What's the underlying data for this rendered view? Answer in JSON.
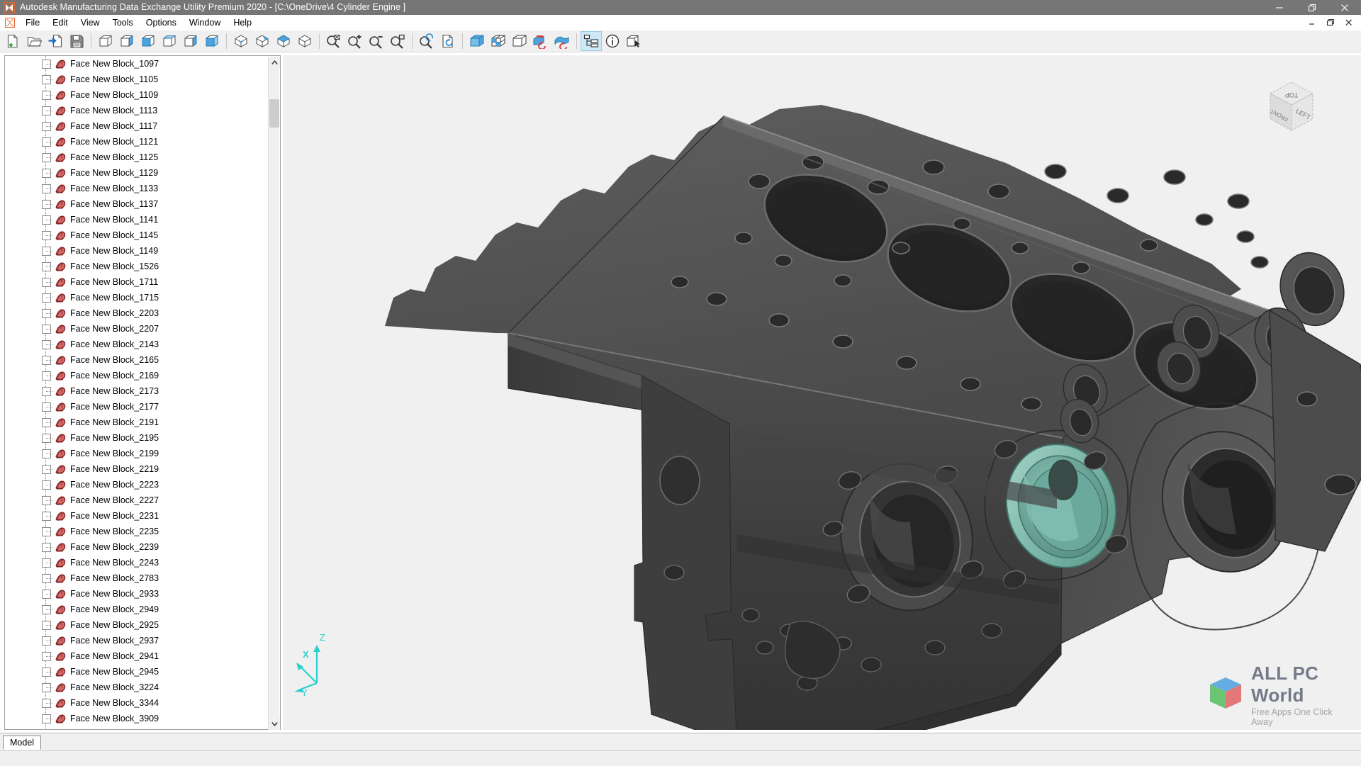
{
  "window": {
    "title": "Autodesk Manufacturing Data Exchange Utility Premium 2020 - [C:\\OneDrive\\4 Cylinder Engine ]",
    "app_icon": "autodesk-logo-icon",
    "controls": [
      {
        "name": "minimize-button",
        "glyph": "minimize-icon"
      },
      {
        "name": "restore-button",
        "glyph": "restore-icon"
      },
      {
        "name": "close-button",
        "glyph": "close-icon"
      }
    ],
    "mdi_controls": [
      {
        "name": "mdi-minimize-button",
        "glyph": "minimize-icon"
      },
      {
        "name": "mdi-restore-button",
        "glyph": "restore-icon"
      },
      {
        "name": "mdi-close-button",
        "glyph": "close-icon"
      }
    ]
  },
  "menubar": {
    "items": [
      {
        "label": "File"
      },
      {
        "label": "Edit"
      },
      {
        "label": "View"
      },
      {
        "label": "Tools"
      },
      {
        "label": "Options"
      },
      {
        "label": "Window"
      },
      {
        "label": "Help"
      }
    ]
  },
  "toolbar": {
    "groups": [
      {
        "buttons": [
          {
            "name": "new-file-button",
            "icon": "new-document-icon",
            "active": false
          },
          {
            "name": "open-file-button",
            "icon": "open-folder-icon",
            "active": false
          },
          {
            "name": "import-file-button",
            "icon": "import-document-icon",
            "active": false
          },
          {
            "name": "save-file-button",
            "icon": "save-floppy-icon",
            "active": false
          }
        ]
      },
      {
        "buttons": [
          {
            "name": "view-wireframe-button",
            "icon": "cube-wireframe-icon",
            "active": false
          },
          {
            "name": "view-hidden-line-button",
            "icon": "cube-hidden-line-icon",
            "active": false
          },
          {
            "name": "view-shaded-button",
            "icon": "cube-shaded-icon",
            "active": false
          },
          {
            "name": "view-shaded-edges-button",
            "icon": "cube-shaded-edges-icon",
            "active": false
          },
          {
            "name": "view-bottom-shade-button",
            "icon": "cube-bottom-shade-icon",
            "active": false
          },
          {
            "name": "view-side-shade-button",
            "icon": "cube-side-shade-icon",
            "active": false
          }
        ]
      },
      {
        "buttons": [
          {
            "name": "iso-view-1-button",
            "icon": "iso-cube-top-icon",
            "active": false
          },
          {
            "name": "iso-view-2-button",
            "icon": "iso-cube-corner-icon",
            "active": false
          },
          {
            "name": "iso-view-3-button",
            "icon": "iso-cube-topface-icon",
            "active": false
          },
          {
            "name": "iso-view-4-button",
            "icon": "iso-cube-plain-icon",
            "active": false
          }
        ]
      },
      {
        "buttons": [
          {
            "name": "zoom-fit-button",
            "icon": "zoom-fit-icon",
            "active": false
          },
          {
            "name": "zoom-in-button",
            "icon": "zoom-in-icon",
            "active": false
          },
          {
            "name": "zoom-out-button",
            "icon": "zoom-out-icon",
            "active": false
          },
          {
            "name": "zoom-window-button",
            "icon": "zoom-window-icon",
            "active": false
          }
        ]
      },
      {
        "buttons": [
          {
            "name": "zoom-previous-button",
            "icon": "zoom-refresh-icon",
            "active": false
          },
          {
            "name": "refresh-document-button",
            "icon": "document-refresh-icon",
            "active": false
          }
        ]
      },
      {
        "buttons": [
          {
            "name": "solid-display-button",
            "icon": "solid-cube-icon",
            "active": false
          },
          {
            "name": "section-display-button",
            "icon": "sectioned-cube-icon",
            "active": false
          },
          {
            "name": "transparent-display-button",
            "icon": "transparent-cube-icon",
            "active": false
          },
          {
            "name": "regenerate-faces-button",
            "icon": "faces-refresh-icon",
            "active": false
          },
          {
            "name": "regenerate-surfaces-button",
            "icon": "surfaces-refresh-icon",
            "active": false
          }
        ]
      },
      {
        "buttons": [
          {
            "name": "model-tree-toggle-button",
            "icon": "tree-structure-icon",
            "active": true
          },
          {
            "name": "info-button",
            "icon": "info-circle-icon",
            "active": false
          },
          {
            "name": "pick-entity-button",
            "icon": "cube-pointer-icon",
            "active": false
          }
        ]
      }
    ]
  },
  "tree": {
    "node_icon": "face-surface-icon",
    "checkbox_state": "unchecked",
    "items": [
      {
        "label": "Face New Block_1097"
      },
      {
        "label": "Face New Block_1105"
      },
      {
        "label": "Face New Block_1109"
      },
      {
        "label": "Face New Block_1113"
      },
      {
        "label": "Face New Block_1117"
      },
      {
        "label": "Face New Block_1121"
      },
      {
        "label": "Face New Block_1125"
      },
      {
        "label": "Face New Block_1129"
      },
      {
        "label": "Face New Block_1133"
      },
      {
        "label": "Face New Block_1137"
      },
      {
        "label": "Face New Block_1141"
      },
      {
        "label": "Face New Block_1145"
      },
      {
        "label": "Face New Block_1149"
      },
      {
        "label": "Face New Block_1526"
      },
      {
        "label": "Face New Block_1711"
      },
      {
        "label": "Face New Block_1715"
      },
      {
        "label": "Face New Block_2203"
      },
      {
        "label": "Face New Block_2207"
      },
      {
        "label": "Face New Block_2143"
      },
      {
        "label": "Face New Block_2165"
      },
      {
        "label": "Face New Block_2169"
      },
      {
        "label": "Face New Block_2173"
      },
      {
        "label": "Face New Block_2177"
      },
      {
        "label": "Face New Block_2191"
      },
      {
        "label": "Face New Block_2195"
      },
      {
        "label": "Face New Block_2199"
      },
      {
        "label": "Face New Block_2219"
      },
      {
        "label": "Face New Block_2223"
      },
      {
        "label": "Face New Block_2227"
      },
      {
        "label": "Face New Block_2231"
      },
      {
        "label": "Face New Block_2235"
      },
      {
        "label": "Face New Block_2239"
      },
      {
        "label": "Face New Block_2243"
      },
      {
        "label": "Face New Block_2783"
      },
      {
        "label": "Face New Block_2933"
      },
      {
        "label": "Face New Block_2949"
      },
      {
        "label": "Face New Block_2925"
      },
      {
        "label": "Face New Block_2937"
      },
      {
        "label": "Face New Block_2941"
      },
      {
        "label": "Face New Block_2945"
      },
      {
        "label": "Face New Block_3224"
      },
      {
        "label": "Face New Block_3344"
      },
      {
        "label": "Face New Block_3909"
      }
    ],
    "scrollbar": {
      "up_arrow": "chevron-up-icon",
      "down_arrow": "chevron-down-icon"
    }
  },
  "viewport": {
    "background_color": "#f0f0f0",
    "model_name": "4 Cylinder Engine",
    "model_color": "#4a4a4a",
    "highlight_color": "#79b7a8",
    "viewcube": {
      "faces": [
        "TOP",
        "FRONT",
        "LEFT"
      ]
    },
    "triad": {
      "axes": [
        "X",
        "Y",
        "Z"
      ],
      "color": "#29d8d8"
    }
  },
  "tabs": {
    "items": [
      {
        "label": "Model",
        "active": true
      }
    ]
  },
  "watermark": {
    "title": "ALL PC World",
    "tagline": "Free Apps One Click Away",
    "logo": "cube-logo-icon"
  }
}
